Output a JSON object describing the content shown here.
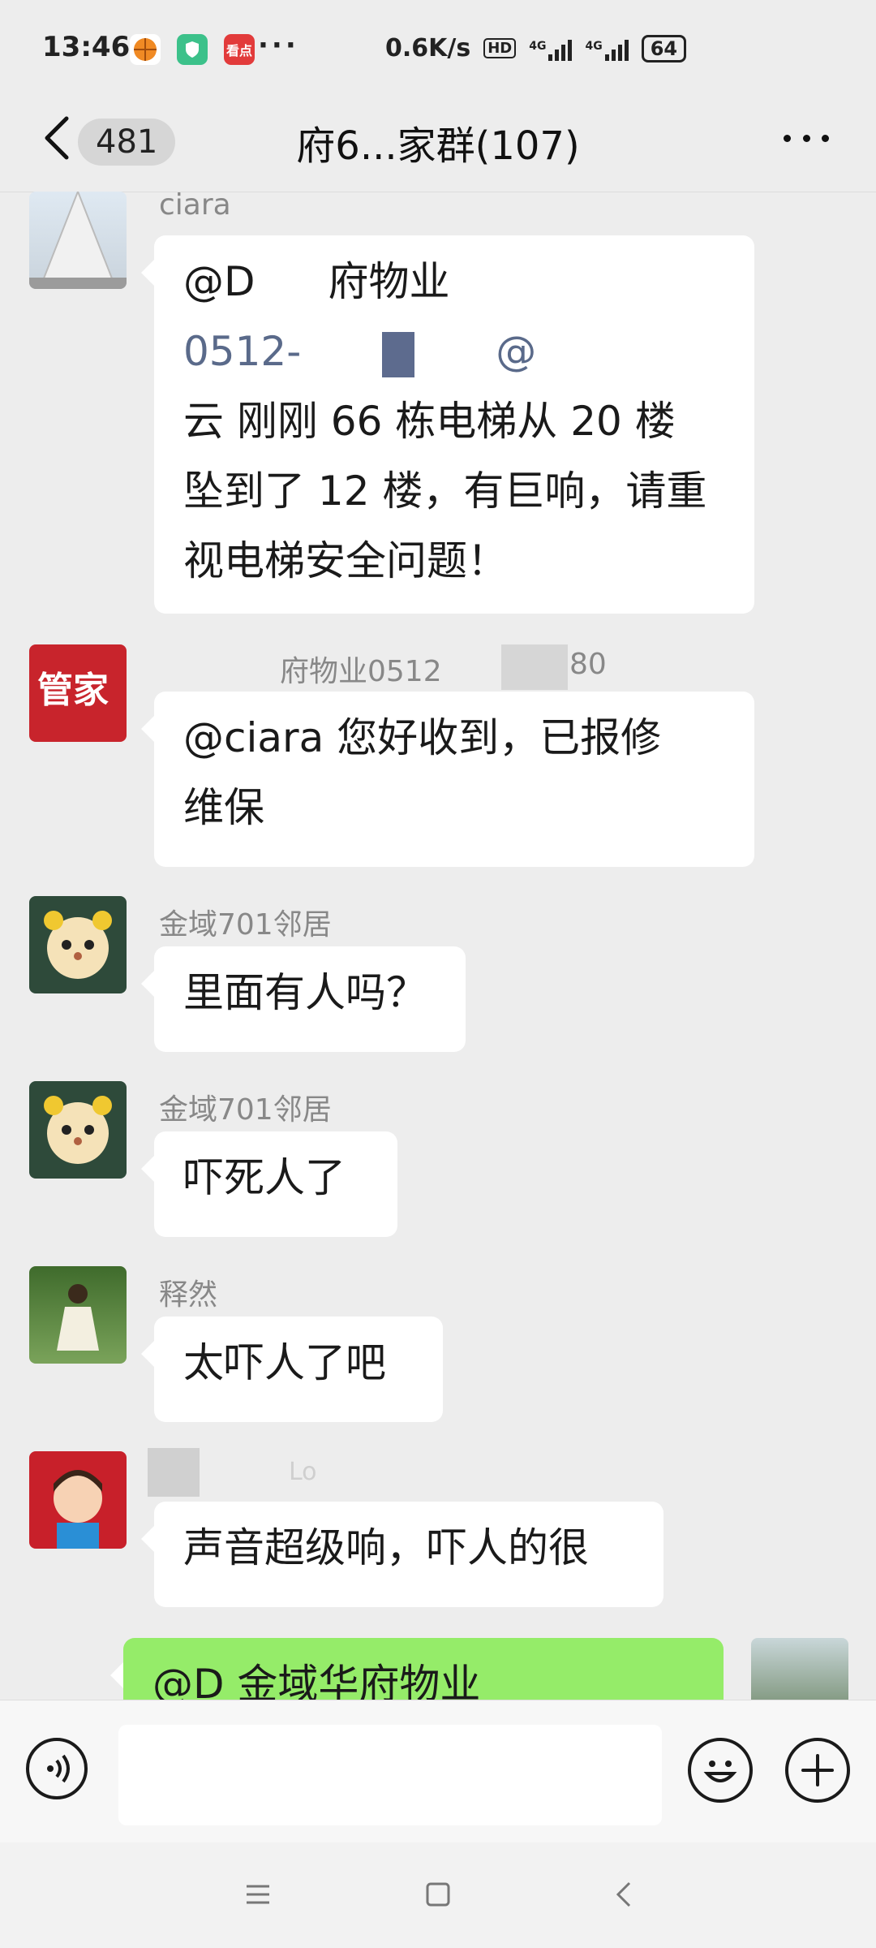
{
  "status_bar": {
    "time": "13:46",
    "app_icons": [
      {
        "name": "basketball-app-icon",
        "color": "#f5a623"
      },
      {
        "name": "shield-app-icon",
        "color": "#3cc18a"
      },
      {
        "name": "news-app-icon",
        "color": "#e23b3b",
        "text": "看点"
      }
    ],
    "more": "···",
    "net_speed": "0.6K/s",
    "hd": "HD",
    "signal_label_1": "4G",
    "signal_label_2": "4G",
    "battery": "64"
  },
  "header": {
    "unread_count": "481",
    "title": "府6...家群(107)"
  },
  "messages": [
    {
      "sender": "ciara",
      "avatar": "mountain-avatar",
      "lines": [
        "@D",
        "0512-",
        "云  刚刚 66 栋电梯从 20 楼",
        "坠到了 12 楼，有巨响，请重",
        "视电梯安全问题！"
      ]
    },
    {
      "sender": "府物业0512",
      "sender_suffix": "80",
      "avatar": "property-manager-avatar",
      "avatar_text": "管家",
      "lines": [
        "@ciara  您好收到，已报修",
        "维保"
      ]
    },
    {
      "sender": "金域701邻居",
      "avatar": "puppy-avatar",
      "lines": [
        "里面有人吗？"
      ]
    },
    {
      "sender": "金域701邻居",
      "avatar": "puppy-avatar",
      "lines": [
        "吓死人了"
      ]
    },
    {
      "sender": "释然",
      "avatar": "girl-in-forest-avatar",
      "lines": [
        "太吓人了吧"
      ]
    },
    {
      "sender": "Lo",
      "avatar": "cartoon-girl-avatar",
      "lines": [
        "声音超级响，吓人的很"
      ]
    },
    {
      "sender": "",
      "avatar": "landscape-avatar",
      "outgoing": true,
      "lines": [
        "@D 金域华府物业"
      ]
    }
  ],
  "msg1_fragments": {
    "line1_right": "府物业",
    "line2_right": "@"
  },
  "colors": {
    "outgoing_bubble": "#95ec69",
    "incoming_bubble": "#ffffff",
    "background": "#ededed"
  }
}
